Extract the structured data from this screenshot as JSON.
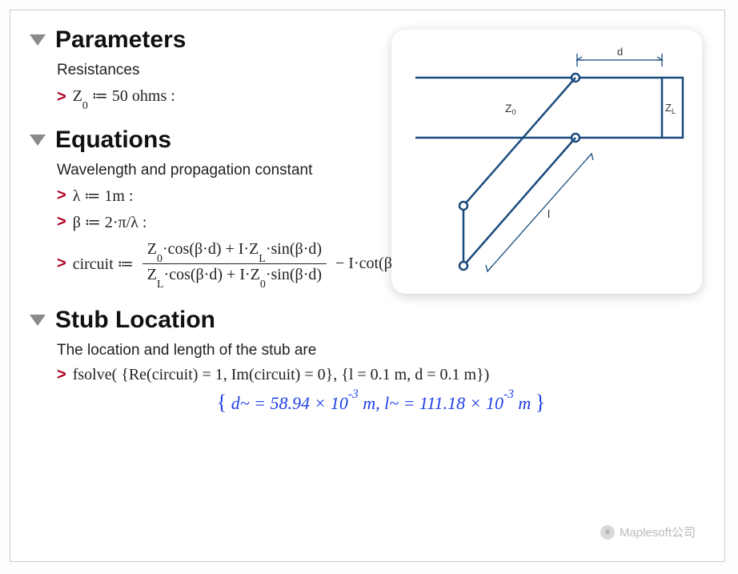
{
  "sections": {
    "parameters": {
      "title": "Parameters",
      "desc": "Resistances",
      "z0_line": "Z₀ ≔ 50 ohms :"
    },
    "equations": {
      "title": "Equations",
      "desc": "Wavelength and propagation constant",
      "lambda_line": "λ ≔ 1m :",
      "beta_line": "β ≔ 2·π/λ :",
      "circuit_label": "circuit ≔",
      "circuit_num": "Z₀·cos(β·d) + I·Z_L·sin(β·d)",
      "circuit_den": "Z_L·cos(β·d) + I·Z₀·sin(β·d)",
      "circuit_tail": "− I·cot(β·I) :"
    },
    "stub": {
      "title": "Stub Location",
      "desc": "The location and length of the stub are",
      "fsolve_line": "fsolve( {Re(circuit) = 1, Im(circuit) = 0}, {l = 0.1 m, d = 0.1 m})",
      "result": "{ d~ = 58.94 × 10⁻³ m, l~ = 111.18 × 10⁻³ m }"
    }
  },
  "diagram": {
    "label_d": "d",
    "label_l": "l",
    "label_z0": "Z₀",
    "label_zl": "Z_L",
    "stroke": "#1a4b7c"
  },
  "watermark": "Maplesoft公司"
}
